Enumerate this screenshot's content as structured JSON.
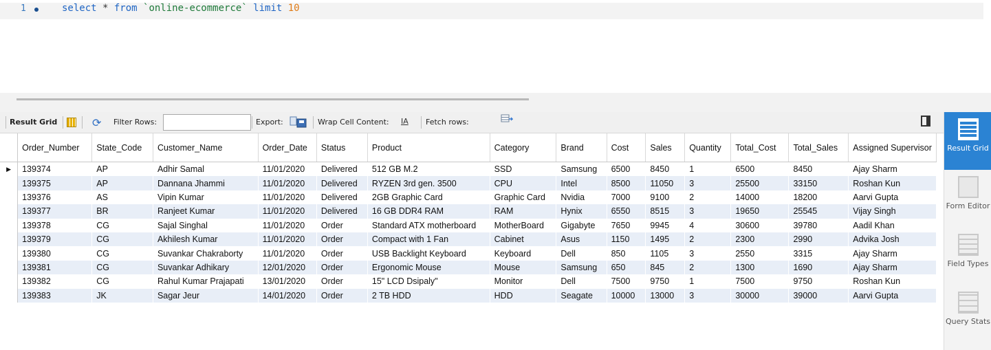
{
  "editor": {
    "line_number": "1",
    "query": {
      "kw1": "select",
      "star": " * ",
      "kw2": "from",
      "table": " `online-ecommerce` ",
      "kw3": "limit",
      "limit": " 10"
    }
  },
  "toolbar": {
    "result_grid_label": "Result Grid",
    "filter_rows_label": "Filter Rows:",
    "filter_value": "",
    "export_label": "Export:",
    "wrap_label": "Wrap Cell Content:",
    "wrap_icon": "IA",
    "fetch_label": "Fetch rows:"
  },
  "grid": {
    "columns": [
      "Order_Number",
      "State_Code",
      "Customer_Name",
      "Order_Date",
      "Status",
      "Product",
      "Category",
      "Brand",
      "Cost",
      "Sales",
      "Quantity",
      "Total_Cost",
      "Total_Sales",
      "Assigned Supervisor"
    ],
    "current_row_marker": "▶",
    "rows": [
      [
        "139374",
        "AP",
        "Adhir Samal",
        "11/01/2020",
        "Delivered",
        "512 GB M.2",
        "SSD",
        "Samsung",
        "6500",
        "8450",
        "1",
        "6500",
        "8450",
        "Ajay Sharm"
      ],
      [
        "139375",
        "AP",
        "Dannana Jhammi",
        "11/01/2020",
        "Delivered",
        "RYZEN 3rd gen. 3500",
        "CPU",
        "Intel",
        "8500",
        "11050",
        "3",
        "25500",
        "33150",
        "Roshan Kun"
      ],
      [
        "139376",
        "AS",
        "Vipin Kumar",
        "11/01/2020",
        "Delivered",
        "2GB Graphic Card",
        "Graphic Card",
        "Nvidia",
        "7000",
        "9100",
        "2",
        "14000",
        "18200",
        "Aarvi Gupta"
      ],
      [
        "139377",
        "BR",
        "Ranjeet Kumar",
        "11/01/2020",
        "Delivered",
        "16 GB DDR4 RAM",
        "RAM",
        "Hynix",
        "6550",
        "8515",
        "3",
        "19650",
        "25545",
        "Vijay Singh"
      ],
      [
        "139378",
        "CG",
        "Sajal Singhal",
        "11/01/2020",
        "Order",
        "Standard ATX motherboard",
        "MotherBoard",
        "Gigabyte",
        "7650",
        "9945",
        "4",
        "30600",
        "39780",
        "Aadil Khan"
      ],
      [
        "139379",
        "CG",
        "Akhilesh Kumar",
        "11/01/2020",
        "Order",
        "Compact with 1 Fan",
        "Cabinet",
        "Asus",
        "1150",
        "1495",
        "2",
        "2300",
        "2990",
        "Advika Josh"
      ],
      [
        "139380",
        "CG",
        "Suvankar Chakraborty",
        "11/01/2020",
        "Order",
        "USB Backlight Keyboard",
        "Keyboard",
        "Dell",
        "850",
        "1105",
        "3",
        "2550",
        "3315",
        "Ajay Sharm"
      ],
      [
        "139381",
        "CG",
        "Suvankar Adhikary",
        "12/01/2020",
        "Order",
        "Ergonomic Mouse",
        "Mouse",
        "Samsung",
        "650",
        "845",
        "2",
        "1300",
        "1690",
        "Ajay Sharm"
      ],
      [
        "139382",
        "CG",
        "Rahul Kumar Prajapati",
        "13/01/2020",
        "Order",
        "15\" LCD Dsipaly\"",
        "Monitor",
        "Dell",
        "7500",
        "9750",
        "1",
        "7500",
        "9750",
        "Roshan Kun"
      ],
      [
        "139383",
        "JK",
        "Sagar Jeur",
        "14/01/2020",
        "Order",
        "2 TB HDD",
        "HDD",
        "Seagate",
        "10000",
        "13000",
        "3",
        "30000",
        "39000",
        "Aarvi Gupta"
      ]
    ]
  },
  "side_panel": {
    "items": [
      {
        "label": "Result Grid",
        "icon": "result-grid-icon",
        "active": true
      },
      {
        "label": "Form Editor",
        "icon": "form-editor-icon",
        "active": false
      },
      {
        "label": "Field Types",
        "icon": "field-types-icon",
        "active": false
      },
      {
        "label": "Query Stats",
        "icon": "query-stats-icon",
        "active": false
      }
    ]
  },
  "colors": {
    "keyword": "#1f65c4",
    "number": "#e07b16",
    "active_panel": "#2b83d3",
    "alt_row": "#e8eef7"
  }
}
